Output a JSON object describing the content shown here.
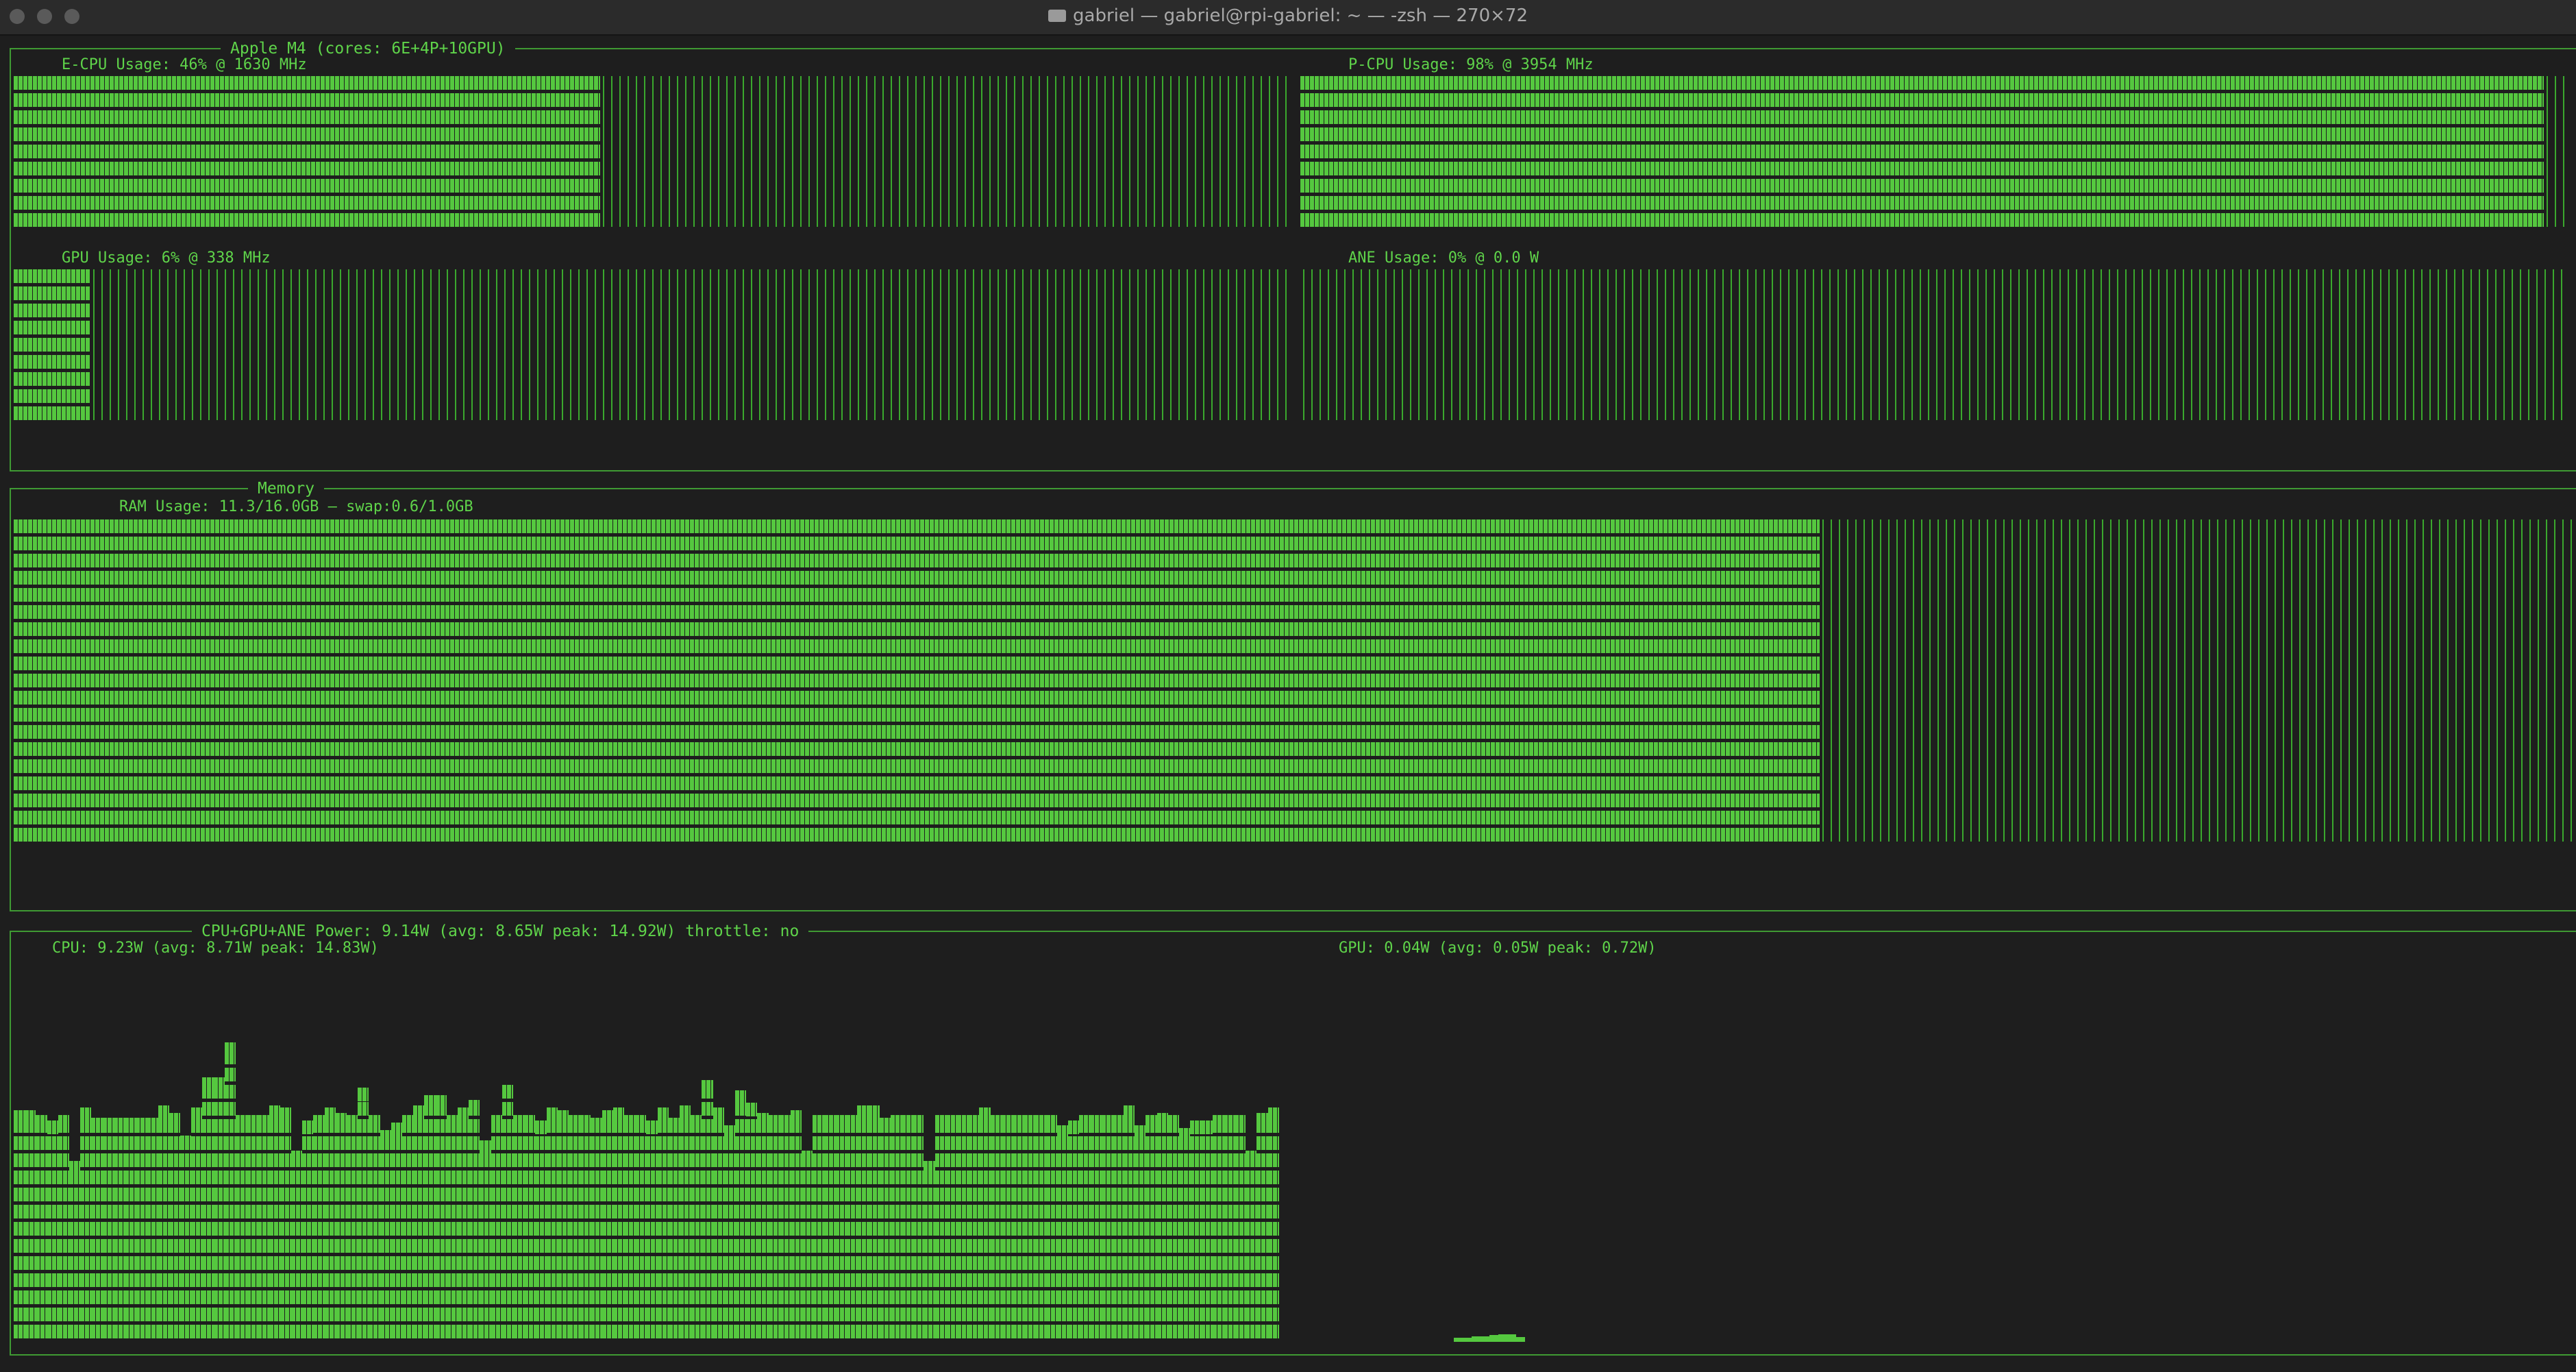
{
  "window": {
    "title": "gabriel — gabriel@rpi-gabriel: ~ — -zsh — 270×72",
    "folder_icon": "folder-icon"
  },
  "colors": {
    "background": "#1e1e1e",
    "accent": "#5fd44a",
    "border": "#3f9a33"
  },
  "cpu_panel": {
    "title": "Apple M4 (cores: 6E+4P+10GPU)",
    "ecpu": {
      "label": "E-CPU Usage: 46% @ 1630 MHz",
      "usage": 0.46
    },
    "pcpu": {
      "label": "P-CPU Usage: 98% @ 3954 MHz",
      "usage": 0.98
    },
    "gpu": {
      "label": "GPU Usage: 6% @ 338 MHz",
      "usage": 0.06
    },
    "ane": {
      "label": "ANE Usage: 0% @ 0.0 W",
      "usage": 0.0
    }
  },
  "memory_panel": {
    "title": "Memory",
    "ram": {
      "label": "RAM Usage: 11.3/16.0GB – swap:0.6/1.0GB",
      "usage": 0.706
    }
  },
  "power_panel": {
    "title": "CPU+GPU+ANE Power: 9.14W (avg: 8.65W peak: 14.92W) throttle: no",
    "cpu": {
      "label": "CPU: 9.23W (avg: 8.71W peak: 14.83W)",
      "history": [
        9.2,
        9.2,
        9.0,
        8.8,
        9.0,
        7.2,
        9.3,
        8.9,
        8.9,
        8.9,
        8.9,
        8.9,
        8.9,
        9.4,
        9.1,
        8.2,
        9.3,
        10.5,
        10.5,
        11.9,
        9.0,
        9.0,
        9.0,
        9.4,
        9.3,
        7.6,
        8.8,
        9.0,
        9.3,
        9.1,
        9.0,
        10.1,
        9.0,
        8.4,
        8.7,
        9.0,
        9.4,
        9.8,
        9.8,
        9.0,
        9.3,
        9.6,
        8.0,
        9.0,
        10.2,
        9.0,
        9.0,
        8.8,
        9.3,
        9.2,
        9.0,
        9.0,
        8.9,
        9.2,
        9.3,
        9.0,
        9.0,
        8.8,
        9.3,
        8.9,
        9.4,
        9.0,
        10.4,
        9.3,
        8.6,
        10.0,
        9.5,
        9.1,
        9.0,
        9.0,
        9.2,
        7.6,
        9.0,
        9.0,
        9.0,
        9.0,
        9.4,
        9.4,
        8.9,
        9.0,
        9.0,
        9.0,
        7.2,
        9.0,
        9.0,
        9.0,
        9.0,
        9.3,
        9.0,
        9.0,
        9.0,
        9.0,
        9.0,
        9.0,
        8.6,
        8.8,
        9.0,
        9.0,
        9.0,
        9.0,
        9.4,
        8.6,
        9.0,
        9.1,
        9.0,
        8.5,
        8.8,
        8.8,
        9.0,
        9.0,
        9.0,
        7.6,
        9.1,
        9.3
      ]
    },
    "gpu": {
      "label": "GPU: 0.04W (avg: 0.05W peak: 0.72W)",
      "history": [
        0.04,
        0.04,
        0.06,
        0.06,
        0.07,
        0.08,
        0.08,
        0.05
      ]
    }
  }
}
